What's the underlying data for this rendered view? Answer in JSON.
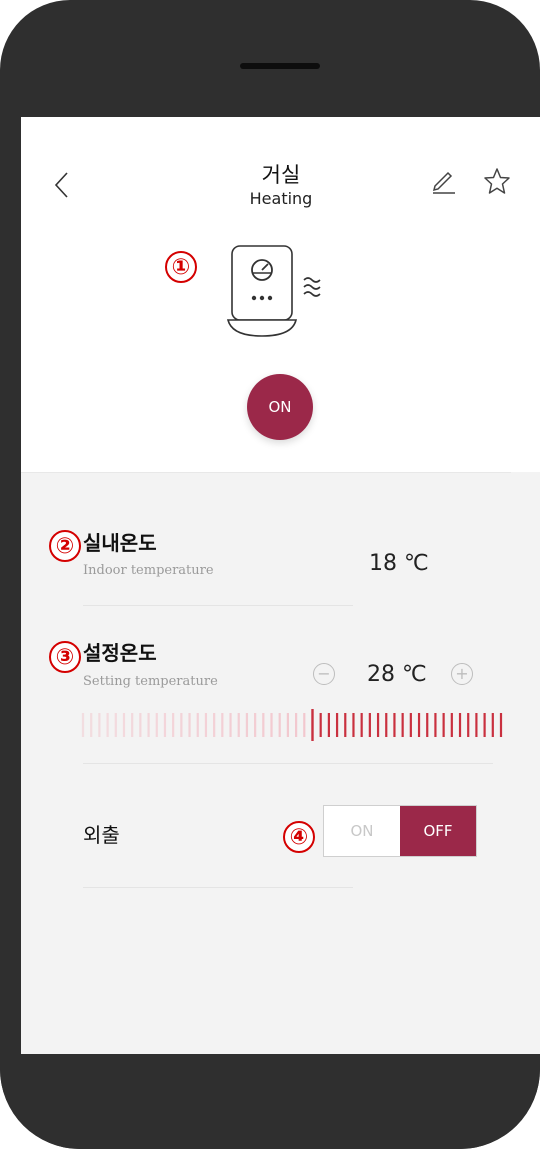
{
  "header": {
    "title": "거실",
    "subtitle": "Heating"
  },
  "device": {
    "power_label": "ON"
  },
  "annotations": {
    "marker1": "①",
    "marker2": "②",
    "marker3": "③",
    "marker4": "④"
  },
  "indoor": {
    "label": "실내온도",
    "sublabel": "Indoor temperature",
    "value": "18 ℃"
  },
  "setting": {
    "label": "설정온도",
    "sublabel": "Setting temperature",
    "value": "28 ℃",
    "minus": "−",
    "plus": "+",
    "slider_level": 0.55
  },
  "away": {
    "label": "외출",
    "on_label": "ON",
    "off_label": "OFF",
    "selected": "OFF"
  },
  "colors": {
    "accent": "#9b2849",
    "slider_active": "#c9303f",
    "slider_inactive": "#f2b4be",
    "marker": "#d40000"
  }
}
